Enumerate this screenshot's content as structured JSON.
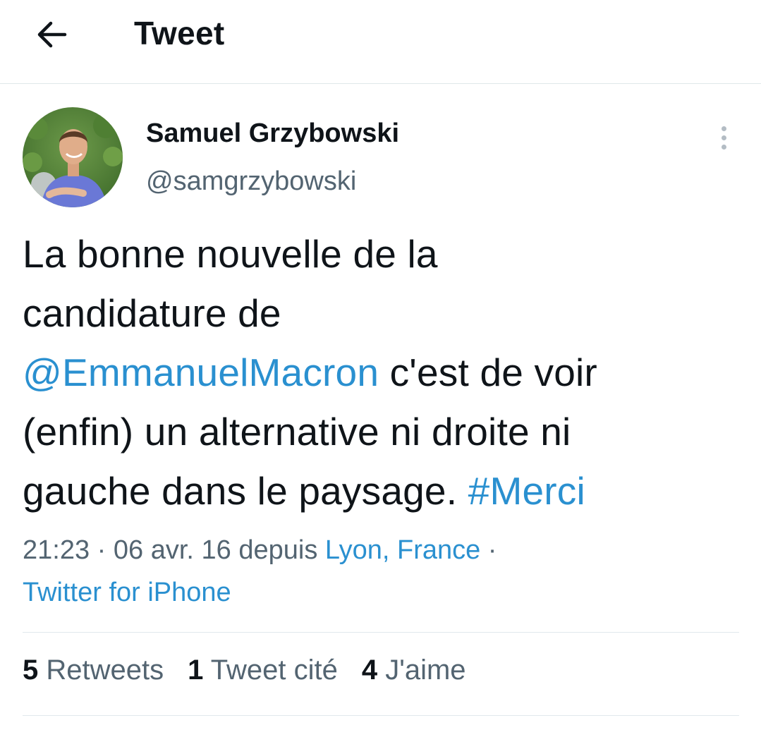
{
  "header": {
    "back_icon": "arrow-left-icon",
    "title": "Tweet"
  },
  "author": {
    "display_name": "Samuel Grzybowski",
    "handle": "@samgrzybowski",
    "avatar_icon": "avatar-photo"
  },
  "tweet": {
    "text_line1": "La bonne nouvelle de la",
    "text_line2": "candidature de",
    "mention": "@EmmanuelMacron",
    "text_line3_rest": " c'est de voir",
    "text_line4": "(enfin) un alternative ni droite ni",
    "text_line5": "gauche dans le paysage. ",
    "hashtag": "#Merci"
  },
  "meta": {
    "time": "21:23",
    "separator": " · ",
    "date": "06 avr. 16",
    "via": " depuis ",
    "location": "Lyon, France",
    "separator2": " ·",
    "source": "Twitter for iPhone"
  },
  "stats": {
    "retweets_count": "5",
    "retweets_label": " Retweets",
    "quotes_count": "1",
    "quotes_label": " Tweet cité",
    "likes_count": "4",
    "likes_label": " J'aime"
  },
  "colors": {
    "link": "#2a90d0",
    "secondary_text": "#536471",
    "primary_text": "#0f1419",
    "divider": "#e1e8ed"
  }
}
